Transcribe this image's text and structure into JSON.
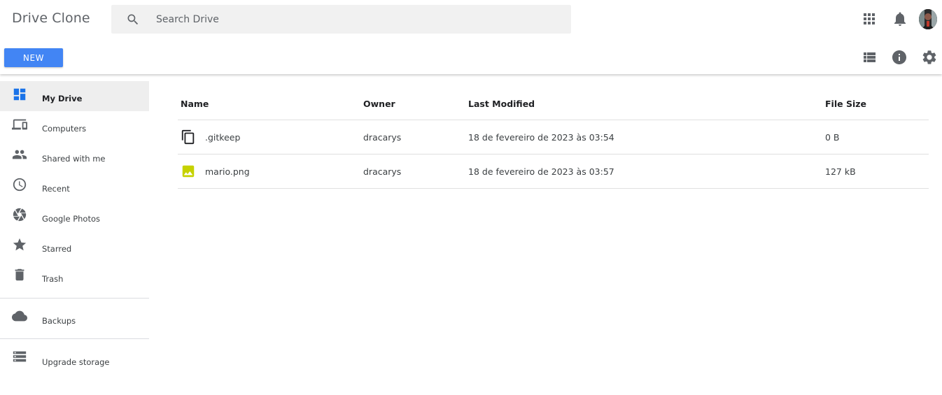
{
  "header": {
    "app_title": "Drive Clone",
    "search_placeholder": "Search Drive",
    "new_button": "NEW"
  },
  "icons": {
    "search": "search-icon",
    "apps": "apps-grid-icon",
    "notifications": "bell-icon",
    "list_view": "list-view-icon",
    "info": "info-icon",
    "settings": "gear-icon"
  },
  "sidebar": {
    "items": [
      {
        "label": "My Drive",
        "icon": "my-drive-icon",
        "active": true
      },
      {
        "label": "Computers",
        "icon": "computers-icon",
        "active": false
      },
      {
        "label": "Shared with me",
        "icon": "people-icon",
        "active": false
      },
      {
        "label": "Recent",
        "icon": "clock-icon",
        "active": false
      },
      {
        "label": "Google Photos",
        "icon": "photos-icon",
        "active": false
      },
      {
        "label": "Starred",
        "icon": "star-icon",
        "active": false
      },
      {
        "label": "Trash",
        "icon": "trash-icon",
        "active": false
      }
    ],
    "backups": {
      "label": "Backups",
      "icon": "cloud-icon"
    },
    "upgrade": {
      "label": "Upgrade storage",
      "icon": "storage-icon"
    }
  },
  "table": {
    "headers": {
      "name": "Name",
      "owner": "Owner",
      "modified": "Last Modified",
      "size": "File Size"
    },
    "rows": [
      {
        "name": ".gitkeep",
        "owner": "dracarys",
        "modified": "18 de fevereiro de 2023 às 03:54",
        "size": "0 B",
        "icon": "file-copy-icon"
      },
      {
        "name": "mario.png",
        "owner": "dracarys",
        "modified": "18 de fevereiro de 2023 às 03:57",
        "size": "127 kB",
        "icon": "image-icon"
      }
    ]
  },
  "colors": {
    "accent": "#4285f4",
    "active_nav_bg": "#eeeeee",
    "my_drive_icon": "#1a73e8",
    "image_icon": "#c6d200",
    "icon_gray": "#5f6368"
  }
}
